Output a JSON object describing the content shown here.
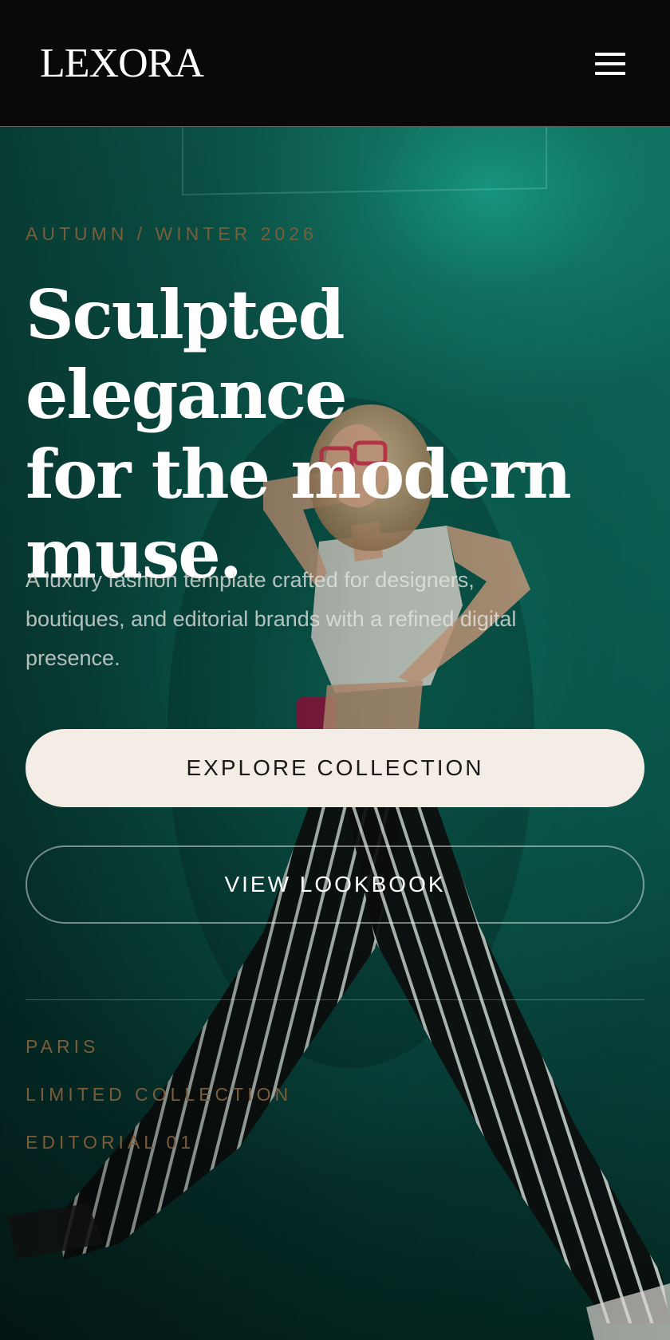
{
  "header": {
    "brand": "LEXORA",
    "menu_icon": "hamburger-menu-icon"
  },
  "hero": {
    "eyebrow": "AUTUMN / WINTER 2026",
    "headline_lines": [
      "Sculpted elegance",
      "for the modern",
      "muse."
    ],
    "subtitle_lines": [
      "A luxury fashion template crafted for designers,",
      "boutiques, and editorial brands with a refined digital",
      "presence."
    ],
    "primary_button": "EXPLORE COLLECTION",
    "secondary_button": "VIEW LOOKBOOK",
    "tags": [
      "PARIS",
      "LIMITED COLLECTION",
      "EDITORIAL 01"
    ],
    "image": "fashion-model-photo"
  },
  "colors": {
    "background_header": "#0a0908",
    "hero_teal": "#0f6e5f",
    "accent_bronze": "#7a5d3b",
    "button_cream": "#f3ede6",
    "text_white": "#ffffff"
  }
}
